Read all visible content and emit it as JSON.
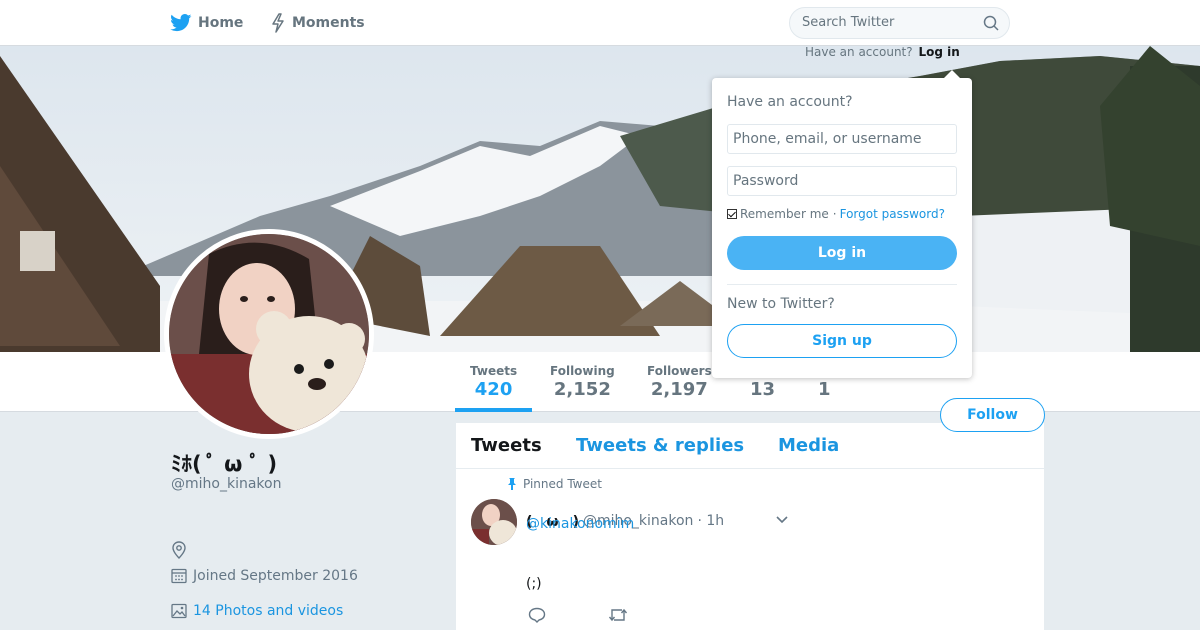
{
  "nav": {
    "home_label": "Home",
    "moments_label": "Moments",
    "search_placeholder": "Search Twitter"
  },
  "auth_prompt": {
    "text": "Have an account?",
    "login_link": "Log in"
  },
  "profile": {
    "display_name": "ﾐﾎ( ﾟ ω ﾟ )",
    "handle": "@miho_kinakon",
    "joined": "Joined September 2016",
    "media_link": "14 Photos and videos"
  },
  "stats": [
    {
      "label": "Tweets",
      "value": "420"
    },
    {
      "label": "Following",
      "value": "2,152"
    },
    {
      "label": "Followers",
      "value": "2,197"
    },
    {
      "label": "",
      "value": "13"
    },
    {
      "label": "",
      "value": "1"
    }
  ],
  "follow_label": "Follow",
  "timeline": {
    "tabs": [
      "Tweets",
      "Tweets & replies",
      "Media"
    ],
    "pinned_label": "Pinned Tweet",
    "tweet": {
      "name": "(　ω　)",
      "handle": "@miho_kinakon",
      "time": "· 1h",
      "mention": "@kinakonomim",
      "text": "(;)"
    }
  },
  "login_dropdown": {
    "title": "Have an account?",
    "username_placeholder": "Phone, email, or username",
    "password_placeholder": "Password",
    "remember_label": "Remember me",
    "separator": "·",
    "forgot_label": "Forgot password?",
    "login_button": "Log in",
    "new_label": "New to Twitter?",
    "signup_button": "Sign up"
  },
  "colors": {
    "brand_blue": "#1da1f2",
    "link_blue": "#1b95e0",
    "login_button_bg": "#4ab3f4"
  }
}
